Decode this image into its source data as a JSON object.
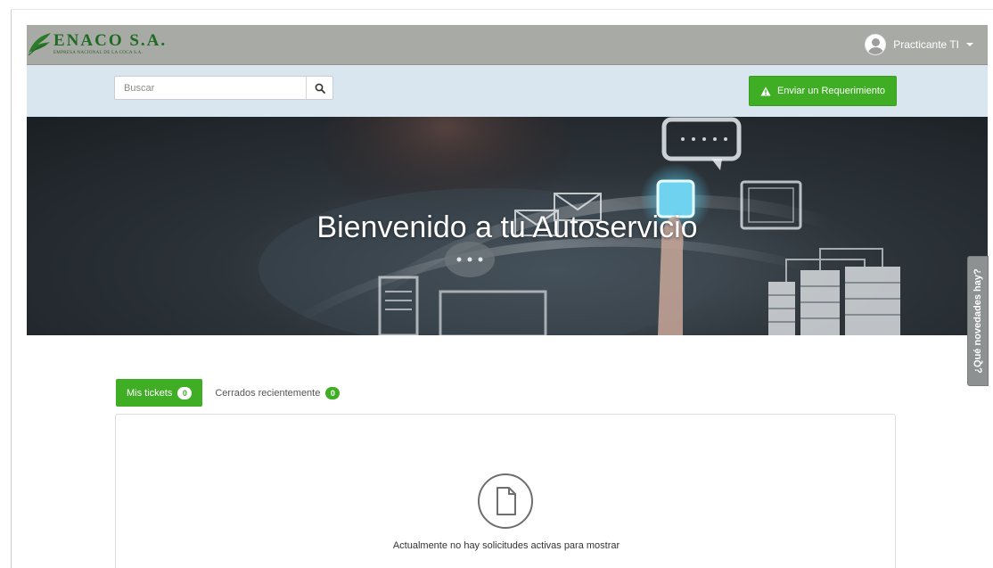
{
  "header": {
    "brand_name": "ENACO S.A.",
    "brand_subtitle": "EMPRESA NACIONAL DE LA COCA S.A.",
    "user_name": "Practicante TI"
  },
  "search": {
    "placeholder": "Buscar"
  },
  "actions": {
    "submit_request_label": "Enviar un Requerimiento"
  },
  "hero": {
    "title": "Bienvenido a tu Autoservicio"
  },
  "side_tab": {
    "label": "¿Qué novedades hay?"
  },
  "tabs": [
    {
      "label": "Mis tickets",
      "count": "0",
      "active": true
    },
    {
      "label": "Cerrados recientemente",
      "count": "0",
      "active": false
    }
  ],
  "panel": {
    "empty_message": "Actualmente no hay solicitudes activas para mostrar"
  },
  "colors": {
    "accent_green": "#3fae25",
    "header_gray": "#a8aaa6",
    "search_band": "#d9e6ef"
  }
}
